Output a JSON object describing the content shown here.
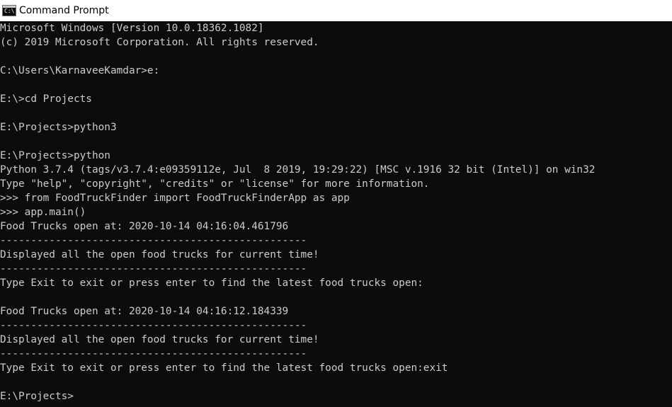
{
  "window": {
    "title": "Command Prompt",
    "icon": "console-icon",
    "icon_glyph": "C:\\",
    "colors": {
      "titlebar_bg": "#ffffff",
      "console_bg": "#0c0c0c",
      "console_fg": "#cccccc"
    }
  },
  "console": {
    "lines": [
      "Microsoft Windows [Version 10.0.18362.1082]",
      "(c) 2019 Microsoft Corporation. All rights reserved.",
      "",
      "C:\\Users\\KarnaveeKamdar>e:",
      "",
      "E:\\>cd Projects",
      "",
      "E:\\Projects>python3",
      "",
      "E:\\Projects>python",
      "Python 3.7.4 (tags/v3.7.4:e09359112e, Jul  8 2019, 19:29:22) [MSC v.1916 32 bit (Intel)] on win32",
      "Type \"help\", \"copyright\", \"credits\" or \"license\" for more information.",
      ">>> from FoodTruckFinder import FoodTruckFinderApp as app",
      ">>> app.main()",
      "Food Trucks open at: 2020-10-14 04:16:04.461796",
      "--------------------------------------------------",
      "Displayed all the open food trucks for current time!",
      "--------------------------------------------------",
      "Type Exit to exit or press enter to find the latest food trucks open:",
      "",
      "Food Trucks open at: 2020-10-14 04:16:12.184339",
      "--------------------------------------------------",
      "Displayed all the open food trucks for current time!",
      "--------------------------------------------------",
      "Type Exit to exit or press enter to find the latest food trucks open:exit",
      "",
      "E:\\Projects>"
    ]
  }
}
